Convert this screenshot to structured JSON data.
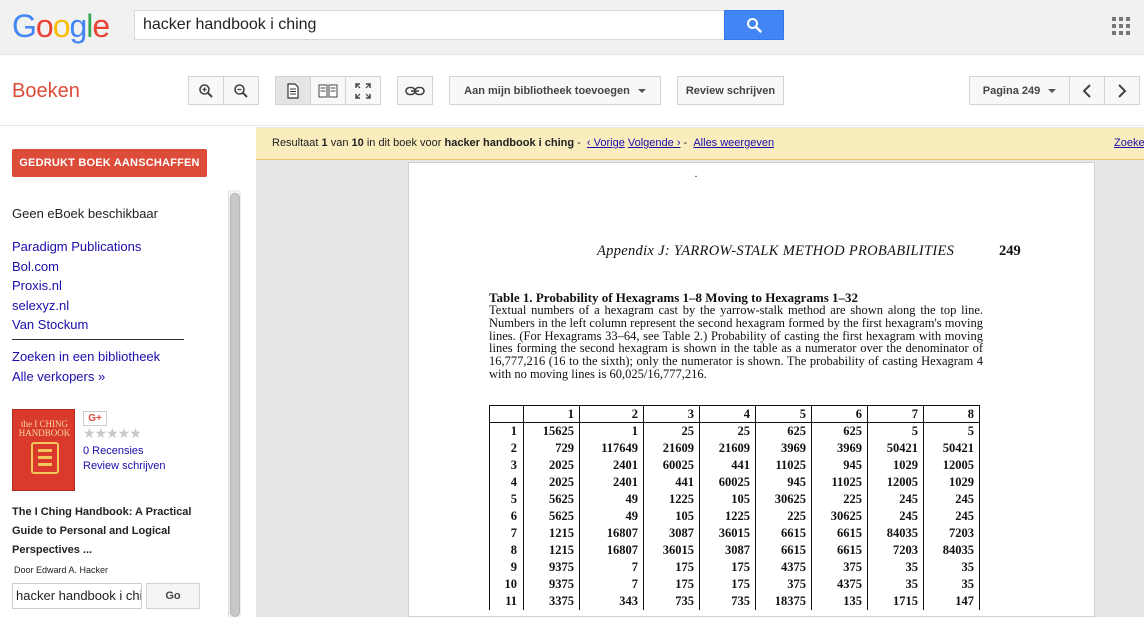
{
  "header": {
    "logo_letters": [
      {
        "ch": "G",
        "color": "#4285f4"
      },
      {
        "ch": "o",
        "color": "#ea4335"
      },
      {
        "ch": "o",
        "color": "#fbbc05"
      },
      {
        "ch": "g",
        "color": "#4285f4"
      },
      {
        "ch": "l",
        "color": "#34a853"
      },
      {
        "ch": "e",
        "color": "#ea4335"
      }
    ],
    "search_query": "hacker handbook i ching"
  },
  "toolbar": {
    "brand": "Boeken",
    "add_library_label": "Aan mijn bibliotheek toevoegen",
    "review_label": "Review schrijven",
    "page_select_label": "Pagina 249"
  },
  "sidebar": {
    "buy_button": "GEDRUKT BOEK AANSCHAFFEN",
    "no_ebook": "Geen eBoek beschikbaar",
    "sellers": [
      "Paradigm Publications",
      "Bol.com",
      "Proxis.nl",
      "selexyz.nl",
      "Van Stockum"
    ],
    "library_link": "Zoeken in een bibliotheek",
    "all_sellers_link": "Alle verkopers »",
    "gplus": "G+",
    "stars": "★★★★★",
    "reviews_count": "0 Recensies",
    "write_review": "Review schrijven",
    "cover_title": "the I CHING HANDBOOK",
    "book_title": "The I Ching Handbook: A Practical Guide to Personal and Logical Perspectives ...",
    "author": "Door Edward A. Hacker",
    "in_book_query": "hacker handbook i ching",
    "go_label": "Go"
  },
  "result_bar": {
    "prefix": "Resultaat ",
    "current": "1",
    "of": " van ",
    "total": "10",
    "in_book": " in dit boek voor ",
    "query": "hacker handbook i ching",
    "sep1": " - ",
    "prev": "‹ Vorige",
    "next": "Volgende ›",
    "sep2": " - ",
    "all": "Alles weergeven",
    "zoek": "Zoeke"
  },
  "page": {
    "dot": "·",
    "running_head": "Appendix J: YARROW-STALK METHOD PROBABILITIES",
    "page_number": "249",
    "table_title": "Table 1. Probability of Hexagrams 1–8 Moving to Hexagrams 1–32",
    "table_desc": "Textual numbers of a hexagram cast by the yarrow-stalk method are shown along the top line. Numbers in the left column represent the second hexagram formed by the first hexagram's moving lines. (For Hexagrams 33–64, see Table 2.) Probability of casting the first hexagram with moving lines forming the second hexagram is shown in the table as a numerator over the denominator of 16,777,216 (16 to the sixth); only the numerator is shown. The probability of casting Hexagram 4 with no moving lines is 60,025/16,777,216.",
    "columns": [
      "",
      "1",
      "2",
      "3",
      "4",
      "5",
      "6",
      "7",
      "8"
    ],
    "rows": [
      [
        "1",
        "15625",
        "1",
        "25",
        "25",
        "625",
        "625",
        "5",
        "5"
      ],
      [
        "2",
        "729",
        "117649",
        "21609",
        "21609",
        "3969",
        "3969",
        "50421",
        "50421"
      ],
      [
        "3",
        "2025",
        "2401",
        "60025",
        "441",
        "11025",
        "945",
        "1029",
        "12005"
      ],
      [
        "4",
        "2025",
        "2401",
        "441",
        "60025",
        "945",
        "11025",
        "12005",
        "1029"
      ],
      [
        "5",
        "5625",
        "49",
        "1225",
        "105",
        "30625",
        "225",
        "245",
        "245"
      ],
      [
        "6",
        "5625",
        "49",
        "105",
        "1225",
        "225",
        "30625",
        "245",
        "245"
      ],
      [
        "7",
        "1215",
        "16807",
        "3087",
        "36015",
        "6615",
        "6615",
        "84035",
        "7203"
      ],
      [
        "8",
        "1215",
        "16807",
        "36015",
        "3087",
        "6615",
        "6615",
        "7203",
        "84035"
      ],
      [
        "9",
        "9375",
        "7",
        "175",
        "175",
        "4375",
        "375",
        "35",
        "35"
      ],
      [
        "10",
        "9375",
        "7",
        "175",
        "175",
        "375",
        "4375",
        "35",
        "35"
      ],
      [
        "11",
        "3375",
        "343",
        "735",
        "735",
        "18375",
        "135",
        "1715",
        "147"
      ]
    ]
  }
}
